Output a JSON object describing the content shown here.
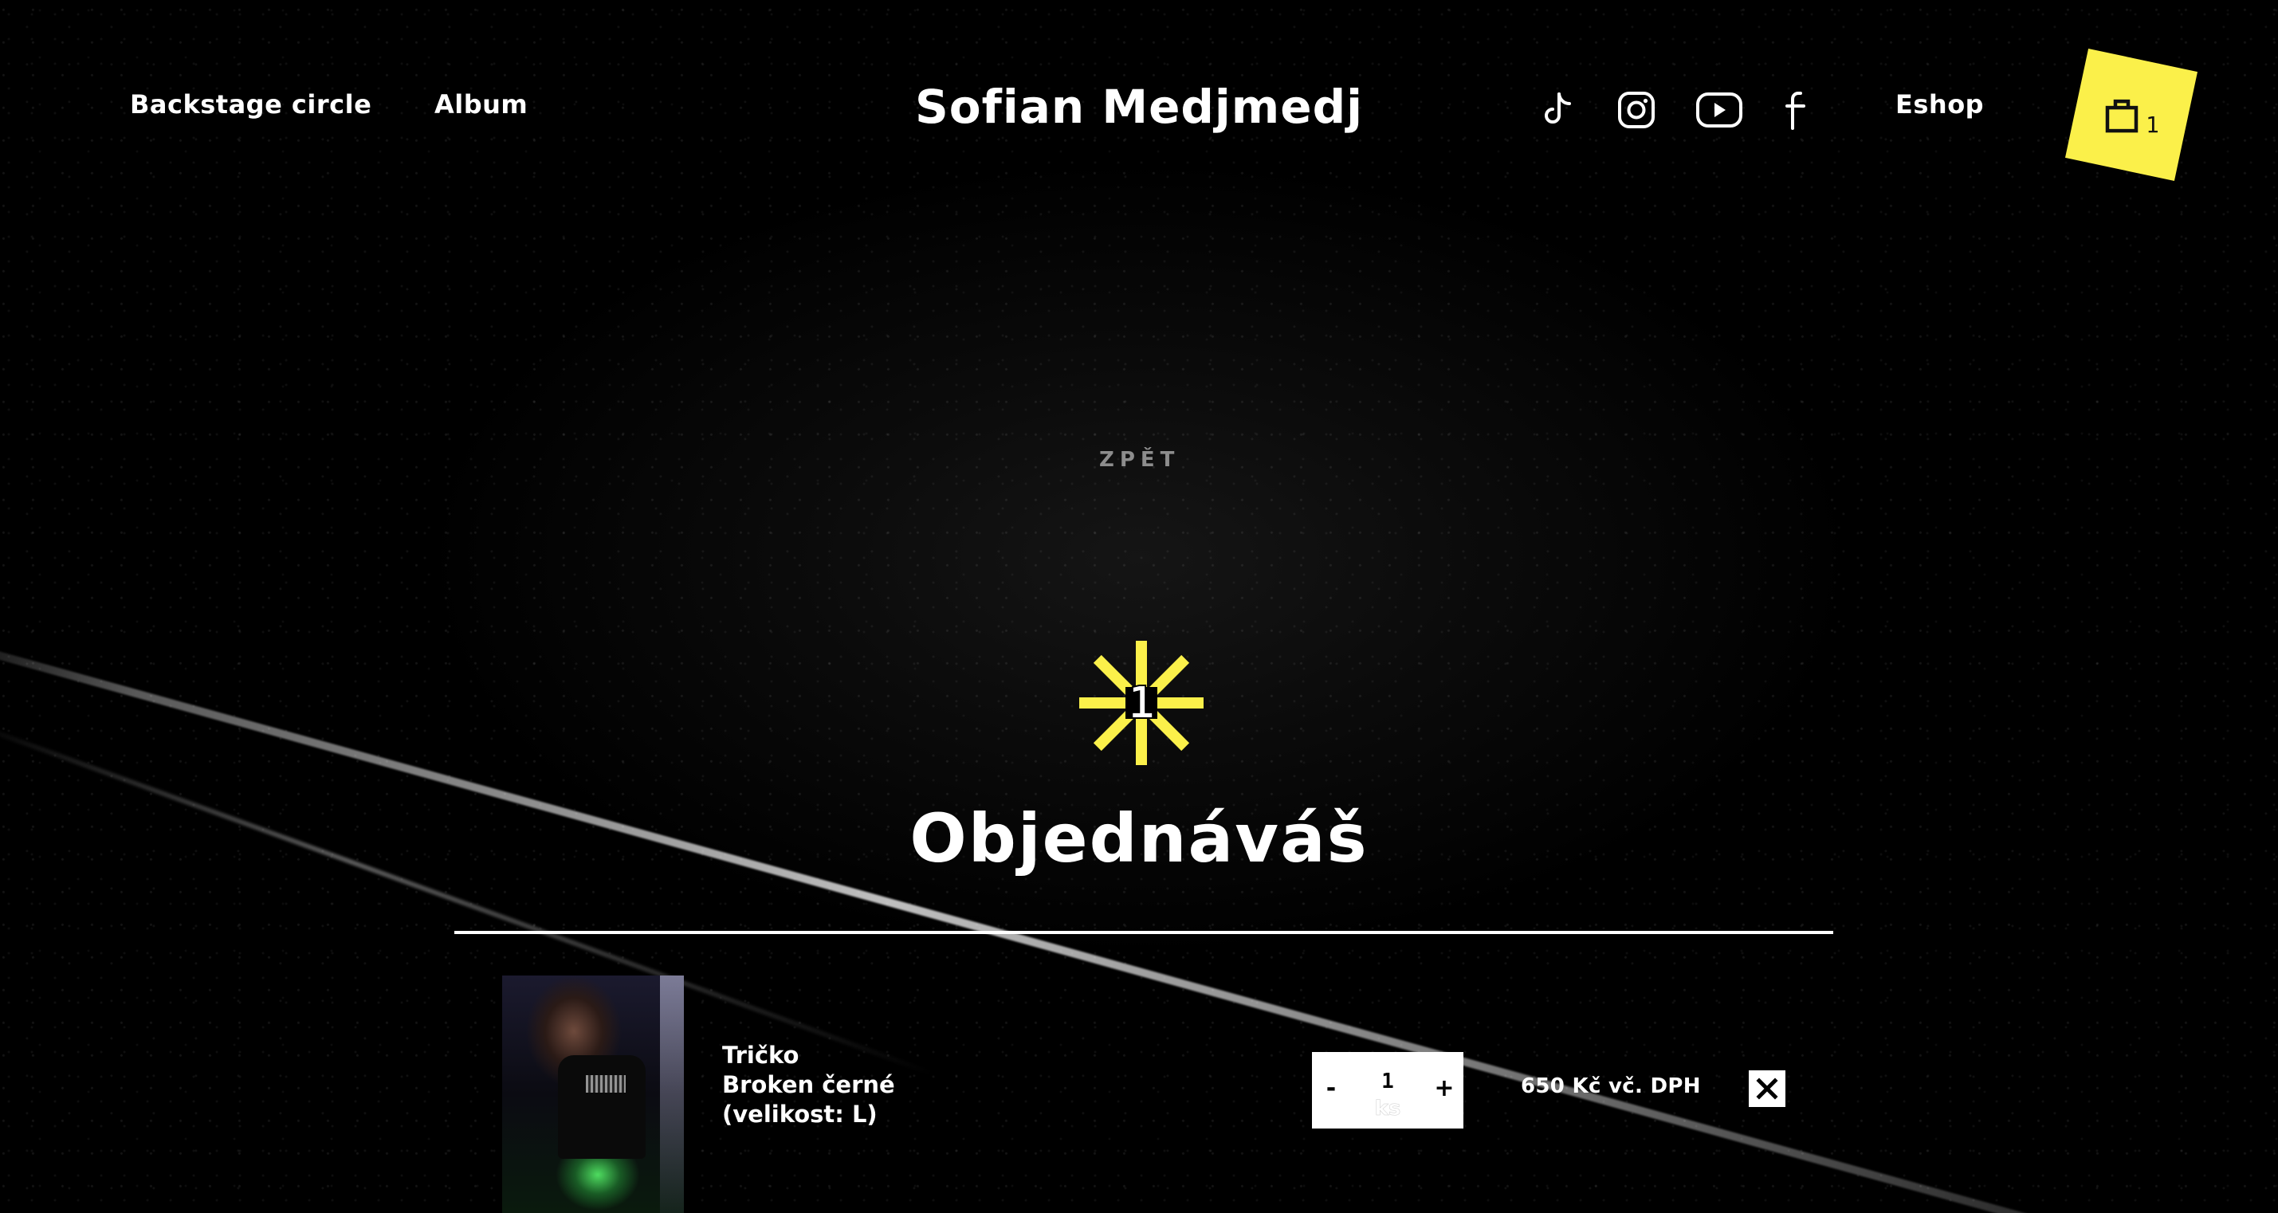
{
  "header": {
    "nav_left": [
      {
        "label": "Backstage circle"
      },
      {
        "label": "Album"
      }
    ],
    "brand": "Sofian Medjmedj",
    "social_icons": [
      "tiktok-icon",
      "instagram-icon",
      "youtube-icon",
      "facebook-icon"
    ],
    "eshop_label": "Eshop",
    "cart": {
      "count": "1",
      "icon": "shopping-bag-icon",
      "color": "#fbf04a"
    }
  },
  "back_label": "ZPĚT",
  "step": {
    "number": "1",
    "color": "#fbf04a"
  },
  "page_title": "Objednáváš",
  "order_item": {
    "name": "Tričko\nBroken černé\n(velikost: L)",
    "quantity": {
      "decrement_label": "-",
      "value": "1",
      "unit": "ks",
      "increment_label": "+"
    },
    "price": "650 Kč vč. DPH",
    "remove_icon": "close-icon"
  }
}
